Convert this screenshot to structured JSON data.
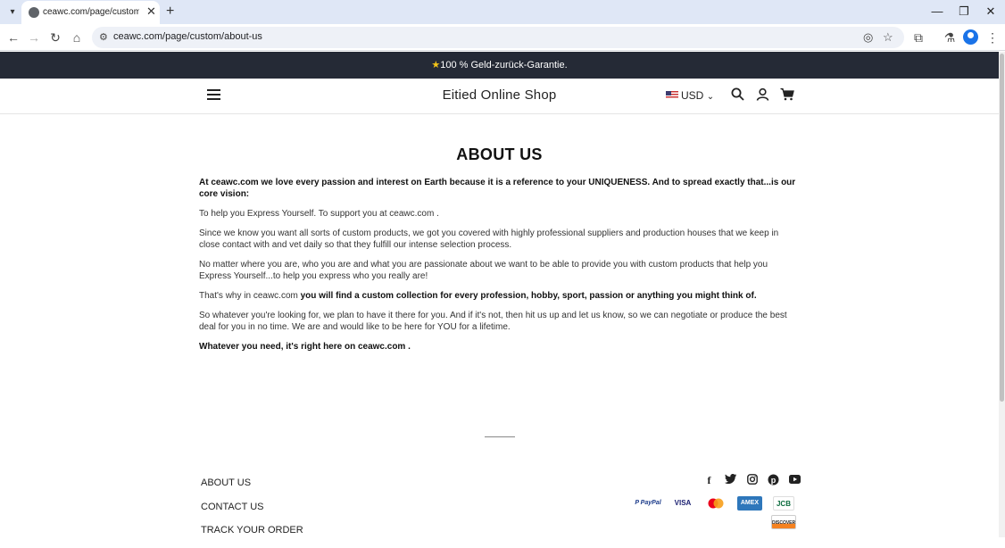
{
  "browser": {
    "tab_title": "ceawc.com/page/custom/abou",
    "url": "ceawc.com/page/custom/about-us"
  },
  "announcement": {
    "text": "100 % Geld-zurück-Garantie."
  },
  "header": {
    "shop_name": "Eitied Online Shop",
    "currency": "USD"
  },
  "page": {
    "heading": "ABOUT US",
    "paragraphs": {
      "p1": "At ceawc.com  we love every passion and interest on Earth because it is a reference to your UNIQUENESS. And to spread exactly that...is our core vision:",
      "p2": "To help you Express Yourself. To support you at ceawc.com .",
      "p3": "Since we know you want all sorts of custom products, we got you covered with highly professional suppliers and production houses that we keep in close contact with and vet daily so that they fulfill our intense selection process.",
      "p4": "No matter where you are, who you are and what you are passionate about we want to be able to provide you with custom products that help you Express Yourself...to help you express who you really are!",
      "p5_lead": "That's why in ceawc.com ",
      "p5_bold": " you will find a custom collection for every profession, hobby, sport, passion or anything you might think of.",
      "p6": "So whatever you're looking for, we plan to have it there for you. And if it's not, then hit us up and let us know, so we can negotiate or produce the best deal for you in no time. We are and would like to be here for YOU for a lifetime.",
      "p7": "Whatever you need, it's right here on ceawc.com ."
    }
  },
  "footer": {
    "links": [
      "ABOUT US",
      "CONTACT US",
      "TRACK YOUR ORDER"
    ],
    "payments": {
      "paypal": "P PayPal",
      "visa": "VISA",
      "amex": "AMEX",
      "jcb": "JCB",
      "discover": "DISCOVER"
    }
  }
}
